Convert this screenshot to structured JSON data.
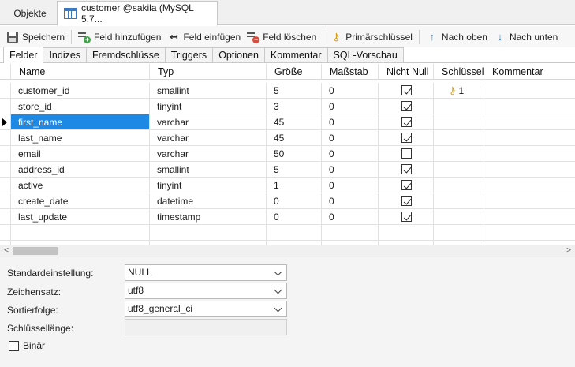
{
  "window_tabs": {
    "objects": "Objekte",
    "active": "customer @sakila (MySQL 5.7..."
  },
  "toolbar": {
    "save": "Speichern",
    "add_field": "Feld hinzufügen",
    "insert_field": "Feld einfügen",
    "delete_field": "Feld löschen",
    "primary_key": "Primärschlüssel",
    "move_up": "Nach oben",
    "move_down": "Nach unten"
  },
  "subtabs": [
    "Felder",
    "Indizes",
    "Fremdschlüsse",
    "Triggers",
    "Optionen",
    "Kommentar",
    "SQL-Vorschau"
  ],
  "grid": {
    "headers": {
      "name": "Name",
      "type": "Typ",
      "size": "Größe",
      "scale": "Maßstab",
      "not_null": "Nicht Null",
      "key": "Schlüssel",
      "comment": "Kommentar"
    },
    "rows": [
      {
        "name": "customer_id",
        "type": "smallint",
        "size": "5",
        "scale": "0",
        "not_null": true,
        "key": "1"
      },
      {
        "name": "store_id",
        "type": "tinyint",
        "size": "3",
        "scale": "0",
        "not_null": true,
        "key": ""
      },
      {
        "name": "first_name",
        "type": "varchar",
        "size": "45",
        "scale": "0",
        "not_null": true,
        "key": ""
      },
      {
        "name": "last_name",
        "type": "varchar",
        "size": "45",
        "scale": "0",
        "not_null": true,
        "key": ""
      },
      {
        "name": "email",
        "type": "varchar",
        "size": "50",
        "scale": "0",
        "not_null": false,
        "key": ""
      },
      {
        "name": "address_id",
        "type": "smallint",
        "size": "5",
        "scale": "0",
        "not_null": true,
        "key": ""
      },
      {
        "name": "active",
        "type": "tinyint",
        "size": "1",
        "scale": "0",
        "not_null": true,
        "key": ""
      },
      {
        "name": "create_date",
        "type": "datetime",
        "size": "0",
        "scale": "0",
        "not_null": true,
        "key": ""
      },
      {
        "name": "last_update",
        "type": "timestamp",
        "size": "0",
        "scale": "0",
        "not_null": true,
        "key": ""
      }
    ]
  },
  "properties": {
    "default_label": "Standardeinstellung:",
    "default_value": "NULL",
    "charset_label": "Zeichensatz:",
    "charset_value": "utf8",
    "collation_label": "Sortierfolge:",
    "collation_value": "utf8_general_ci",
    "keylength_label": "Schlüssellänge:",
    "keylength_value": "",
    "binary_label": "Binär"
  },
  "colors": {
    "selection": "#1e88e5",
    "key_icon": "#d69a17",
    "arrow": "#2f7fd1"
  }
}
